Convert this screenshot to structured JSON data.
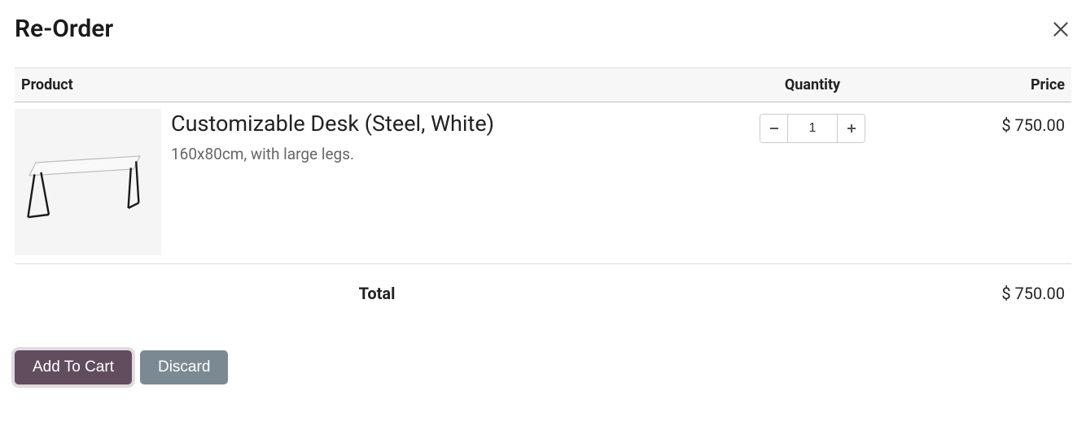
{
  "header": {
    "title": "Re-Order"
  },
  "columns": {
    "product": "Product",
    "quantity": "Quantity",
    "price": "Price"
  },
  "items": [
    {
      "name": "Customizable Desk (Steel, White)",
      "description": "160x80cm, with large legs.",
      "quantity": "1",
      "price": "$ 750.00"
    }
  ],
  "total": {
    "label": "Total",
    "value": "$ 750.00"
  },
  "actions": {
    "add_to_cart": "Add To Cart",
    "discard": "Discard"
  }
}
